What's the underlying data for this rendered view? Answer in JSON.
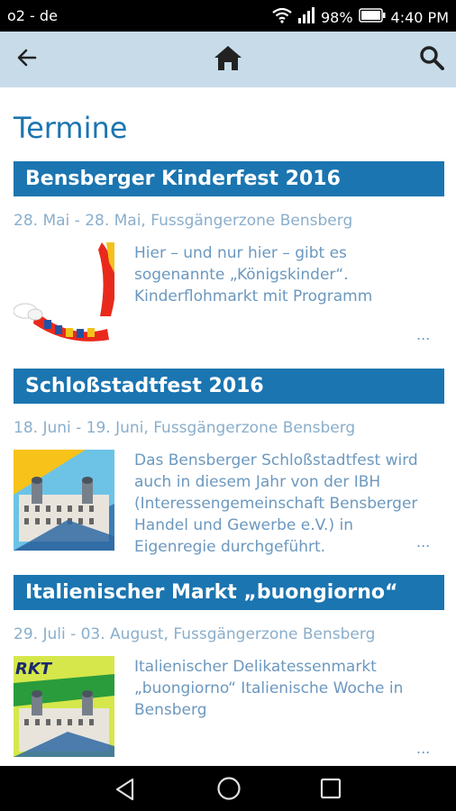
{
  "status_bar": {
    "carrier": "o2 - de",
    "battery": "98%",
    "time": "4:40 PM",
    "icons": [
      "wifi-icon",
      "signal-icon",
      "battery-icon"
    ]
  },
  "app_bar": {
    "icons": [
      "back-arrow-icon",
      "home-icon",
      "search-icon"
    ],
    "background": "#c7dbe9"
  },
  "page": {
    "title": "Termine"
  },
  "events": [
    {
      "title": "Bensberger Kinderfest 2016",
      "date": "28. Mai - 28. Mai, Fussgängerzone Bensberg",
      "description": "Hier – und nur hier – gibt es sogenannte „Königskinder“. Kinderflohmarkt mit Programm",
      "more": "..."
    },
    {
      "title": "Schloßstadtfest 2016",
      "date": "18. Juni - 19. Juni, Fussgängerzone Bensberg",
      "description": "Das Bensberger Schloßstadtfest wird auch in diesem Jahr von der IBH (Interessengemeinschaft Bensberger Handel und Gewerbe e.V.) in Eigenregie durchgeführt.",
      "more": "..."
    },
    {
      "title": "Italienischer Markt „buongiorno“",
      "date": "29. Juli - 03. August, Fussgängerzone Bensberg",
      "description": "Italienischer Delikatessenmarkt „buongiorno“ Italienische Woche in Bensberg",
      "more": "...",
      "thumb_text": "RKT"
    }
  ],
  "nav_bar": {
    "icons": [
      "back-triangle-icon",
      "home-circle-icon",
      "recents-square-icon"
    ]
  },
  "colors": {
    "accent": "#1b75b0",
    "text_muted": "#6c98bf"
  }
}
